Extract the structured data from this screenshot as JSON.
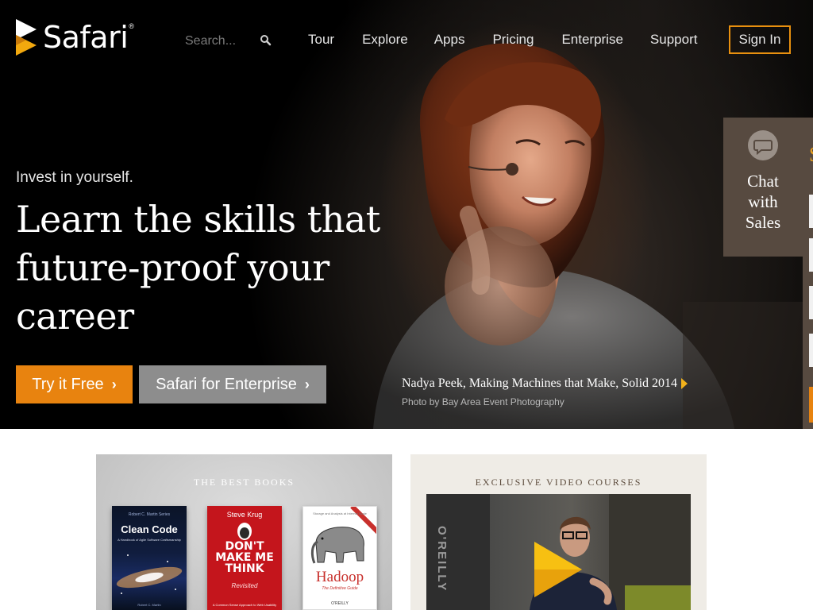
{
  "brand": {
    "name": "Safari",
    "reg": "®",
    "accent": "#e8830f",
    "button_gray": "#8d8d8d",
    "chat_bg": "#574a40"
  },
  "search": {
    "placeholder": "Search..."
  },
  "nav": {
    "items": [
      "Tour",
      "Explore",
      "Apps",
      "Pricing",
      "Enterprise",
      "Support"
    ],
    "sign_in": "Sign In"
  },
  "hero": {
    "tagline": "Invest in yourself.",
    "headline": "Learn the skills that future-proof your career",
    "cta_primary": "Try it Free",
    "cta_secondary": "Safari for Enterprise",
    "caption_title": "Nadya Peek, Making Machines that Make, Solid 2014",
    "caption_credit": "Photo by Bay Area Event Photography"
  },
  "chat": {
    "label": "Chat with Sales"
  },
  "cards": {
    "books": {
      "title": "THE BEST BOOKS",
      "items": [
        {
          "author": "Robert C. Martin Series",
          "title": "Clean Code",
          "subtitle": "A Handbook of Agile Software Craftsmanship",
          "footer": "Robert C. Martin"
        },
        {
          "author": "Steve Krug",
          "title": "DON'T MAKE ME THINK",
          "subtitle": "Revisited",
          "footer": "A Common Sense Approach to Web Usability"
        },
        {
          "author": "Hadoop",
          "title": "Hadoop",
          "subtitle": "The Definitive Guide",
          "footer": "O'REILLY",
          "header": "Storage and Analysis at Internet Scale"
        }
      ]
    },
    "video": {
      "title": "EXCLUSIVE VIDEO COURSES",
      "sign": "O'REILLY"
    }
  }
}
